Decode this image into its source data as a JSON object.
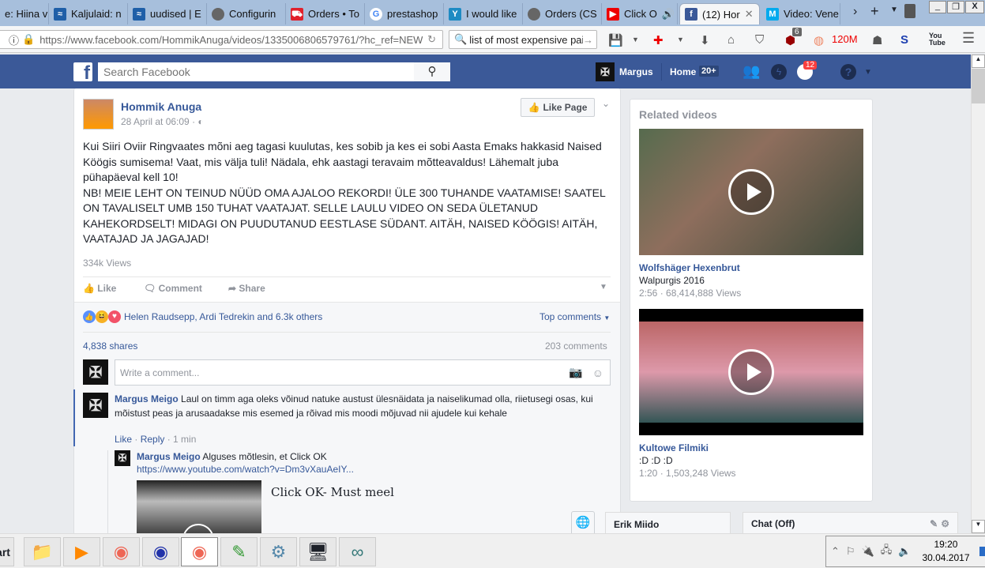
{
  "browser": {
    "tabs": [
      {
        "label": "e: Hiina v",
        "color": "#888"
      },
      {
        "label": "Kaljulaid: n",
        "color": "#1f5fa8"
      },
      {
        "label": "uudised | E",
        "color": "#1f5fa8"
      },
      {
        "label": "Configurin",
        "color": "#555"
      },
      {
        "label": "Orders • To",
        "color": "#e0202b"
      },
      {
        "label": "prestashop",
        "color": "#4285f4"
      },
      {
        "label": "I would like",
        "color": "#1e8bc3"
      },
      {
        "label": "Orders (CS",
        "color": "#555"
      },
      {
        "label": "Click O",
        "color": "#e00"
      },
      {
        "label": "(12) Hor",
        "color": "#3b5998"
      },
      {
        "label": "Video: Vene",
        "color": "#00aaee"
      }
    ],
    "url": "https://www.facebook.com/HommikAnuga/videos/1335006806579761/?hc_ref=NEW",
    "url_domain": "facebook.com",
    "search_value": "list of most expensive paint",
    "ublock_count": "6",
    "memory": "120M"
  },
  "fb": {
    "search_placeholder": "Search Facebook",
    "user": "Margus",
    "home": "Home",
    "home_badge": "20+",
    "notif_count": "12"
  },
  "post": {
    "author": "Hommik Anuga",
    "time": "28 April at 06:09 · ",
    "like_page": "Like Page",
    "text_p1": "Kui Siiri Oviir Ringvaates mõni aeg tagasi kuulutas, kes sobib ja kes ei sobi Aasta Emaks hakkasid Naised Köögis sumisema! Vaat, mis välja tuli! Nädala, ehk aastagi teravaim mõtteavaldus! Lähemalt juba pühapäeval kell 10!",
    "text_p2": "NB! MEIE LEHT ON TEINUD NÜÜD OMA AJALOO REKORDI! ÜLE 300 TUHANDE VAATAMISE! SAATEL ON TAVALISELT UMB 150 TUHAT VAATAJAT. SELLE LAULU VIDEO ON SEDA ÜLETANUD KAHEKORDSELT! MIDAGI ON PUUDUTANUD EESTLASE SÜDANT. AITÄH, NAISED KÖÖGIS! AITÄH, VAATAJAD JA JAGAJAD!",
    "views": "334k Views",
    "actions": {
      "like": "Like",
      "comment": "Comment",
      "share": "Share"
    },
    "reactions": "Helen Raudsepp, Ardi Tedrekin and 6.3k others",
    "top_comments": "Top comments",
    "shares": "4,838 shares",
    "comments_count": "203 comments",
    "comment_placeholder": "Write a comment...",
    "comments": [
      {
        "author": "Margus Meigo",
        "text": "Laul on timm aga oleks võinud natuke austust ülesnäidata ja naiselikumad olla, riietusegi osas, kui mõistust peas ja arusaadakse mis esemed ja rõivad mis moodi mõjuvad nii ajudele kui kehale",
        "like": "Like",
        "reply": "Reply",
        "time": "1 min"
      }
    ],
    "reply": {
      "author": "Margus Meigo",
      "text": "Alguses mõtlesin, et Click OK",
      "link": "https://www.youtube.com/watch?v=Dm3vXauAeIY...",
      "preview_title": "Click OK- Must meel"
    }
  },
  "related": {
    "title": "Related videos",
    "videos": [
      {
        "title": "Wolfshäger Hexenbrut",
        "subtitle": "Walpurgis 2016",
        "meta": "2:56 · 68,414,888 Views"
      },
      {
        "title": "Kultowe Filmiki",
        "subtitle": ":D :D :D",
        "meta": "1:20 · 1,503,248 Views"
      }
    ]
  },
  "chat": {
    "contact": "Erik Miido",
    "chat_label": "Chat (Off)"
  },
  "taskbar": {
    "start": "art",
    "time": "19:20",
    "date": "30.04.2017"
  }
}
